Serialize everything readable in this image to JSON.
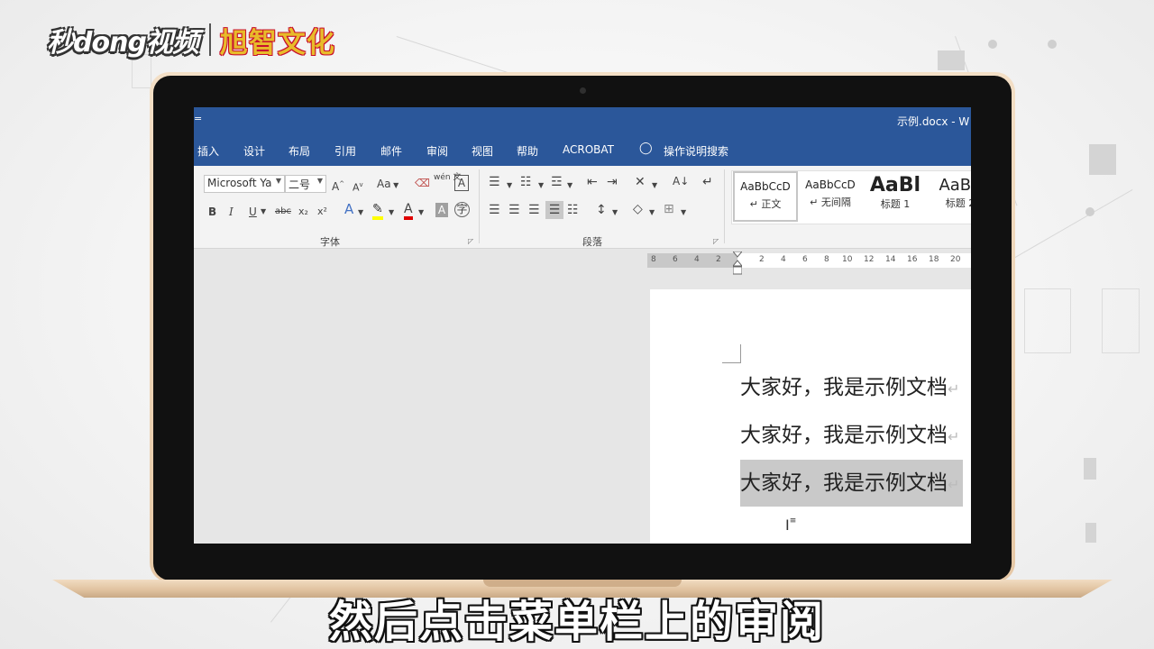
{
  "logo": {
    "left_text": "秒dong视频",
    "right_text": "旭智文化"
  },
  "window": {
    "title": "示例.docx - W",
    "quick_access": "="
  },
  "tabs": [
    "插入",
    "设计",
    "布局",
    "引用",
    "邮件",
    "审阅",
    "视图",
    "帮助",
    "ACROBAT",
    "操作说明搜索"
  ],
  "font_group": {
    "font_name": "Microsoft Ya",
    "font_size": "二号",
    "grow": "A",
    "shrink": "A",
    "case": "Aa",
    "bold": "B",
    "italic": "I",
    "underline": "U",
    "strike": "abc",
    "subscript": "x₂",
    "superscript": "x²",
    "phonetic": "wén 文",
    "label": "字体"
  },
  "paragraph_group": {
    "label": "段落"
  },
  "styles": [
    {
      "preview": "AaBbCcD",
      "name": "正文"
    },
    {
      "preview": "AaBbCcD",
      "name": "无间隔"
    },
    {
      "preview": "AaBl",
      "name": "标题 1"
    },
    {
      "preview": "AaBb",
      "name": "标题 2"
    }
  ],
  "ruler": {
    "ticks": [
      "8",
      "6",
      "4",
      "2",
      "",
      "2",
      "4",
      "6",
      "8",
      "10",
      "12",
      "14",
      "16",
      "18",
      "20"
    ]
  },
  "document": {
    "lines": [
      "大家好，我是示例文档",
      "大家好，我是示例文档",
      "大家好，我是示例文档"
    ],
    "para_mark": "↵"
  },
  "subtitle": "然后点击菜单栏上的审阅",
  "colors": {
    "word_blue": "#2b579a",
    "highlight_gray": "#c9c9c9",
    "laptop_gold": "#e6c8a6"
  }
}
